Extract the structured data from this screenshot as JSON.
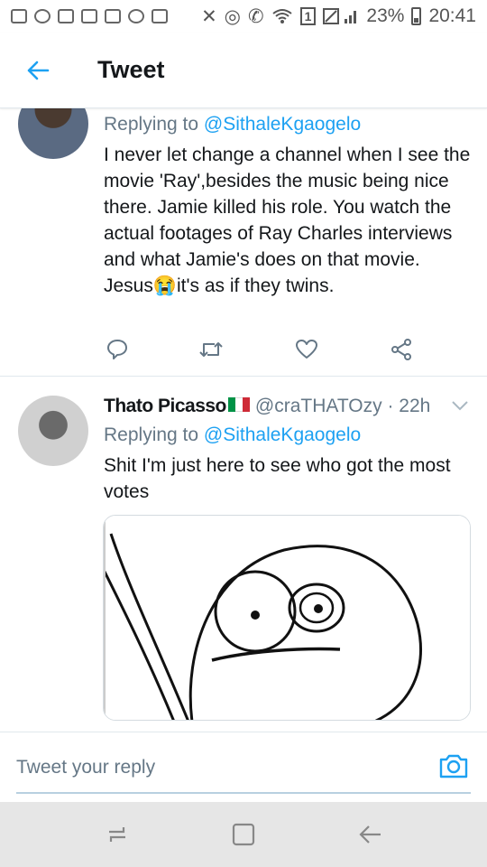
{
  "status_bar": {
    "battery": "23%",
    "time": "20:41",
    "sim": "1"
  },
  "header": {
    "title": "Tweet"
  },
  "tweets": [
    {
      "replying_prefix": "Replying to ",
      "replying_handle": "@SithaleKgaogelo",
      "body_before_emoji": "I never let change a channel when I see the movie 'Ray',besides the music being nice there. Jamie killed his role. You watch the actual footages of Ray Charles interviews\nand what Jamie's does on that movie. Jesus",
      "emoji": "😭",
      "body_after_emoji": "it's as if they twins."
    },
    {
      "name": "Thato Picasso",
      "handle": "@craTHATOzy",
      "time": "22h",
      "replying_prefix": "Replying to ",
      "replying_handle": "@SithaleKgaogelo",
      "body": "Shit I'm just here to see who got the most votes"
    }
  ],
  "reply_bar": {
    "placeholder": "Tweet your reply"
  },
  "icons": {
    "accent": "#1da1f2",
    "names": [
      "back-arrow-icon",
      "reply-icon",
      "retweet-icon",
      "like-icon",
      "share-icon",
      "chevron-down-icon",
      "camera-icon",
      "recents-icon",
      "home-icon",
      "back-nav-icon"
    ]
  }
}
